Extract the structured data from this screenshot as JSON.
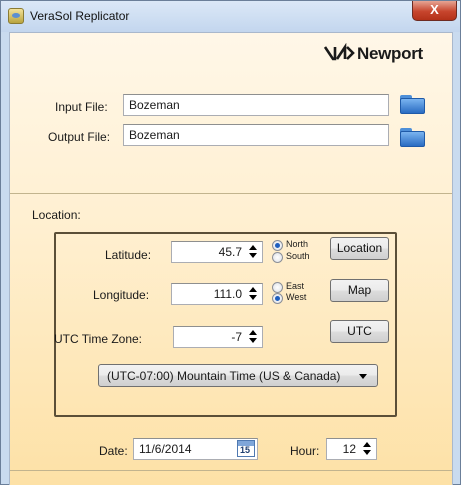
{
  "window": {
    "title": "VeraSol Replicator",
    "close_label": "X"
  },
  "logo": {
    "text": "Newport"
  },
  "files": {
    "input_label": "Input File:",
    "input_value": "Bozeman",
    "output_label": "Output File:",
    "output_value": "Bozeman"
  },
  "location": {
    "section_label": "Location:",
    "latitude_label": "Latitude:",
    "latitude_value": "45.7",
    "north_label": "North",
    "south_label": "South",
    "longitude_label": "Longitude:",
    "longitude_value": "111.0",
    "east_label": "East",
    "west_label": "West",
    "utc_label": "UTC Time Zone:",
    "utc_value": "-7",
    "location_button": "Location",
    "map_button": "Map",
    "utc_button": "UTC",
    "timezone_selected": "(UTC-07:00) Mountain Time (US & Canada)"
  },
  "datetime": {
    "date_label": "Date:",
    "date_value": "11/6/2014",
    "calendar_day": "15",
    "hour_label": "Hour:",
    "hour_value": "12"
  },
  "state": {
    "hemisphere_ns": "North",
    "hemisphere_ew": "West"
  }
}
